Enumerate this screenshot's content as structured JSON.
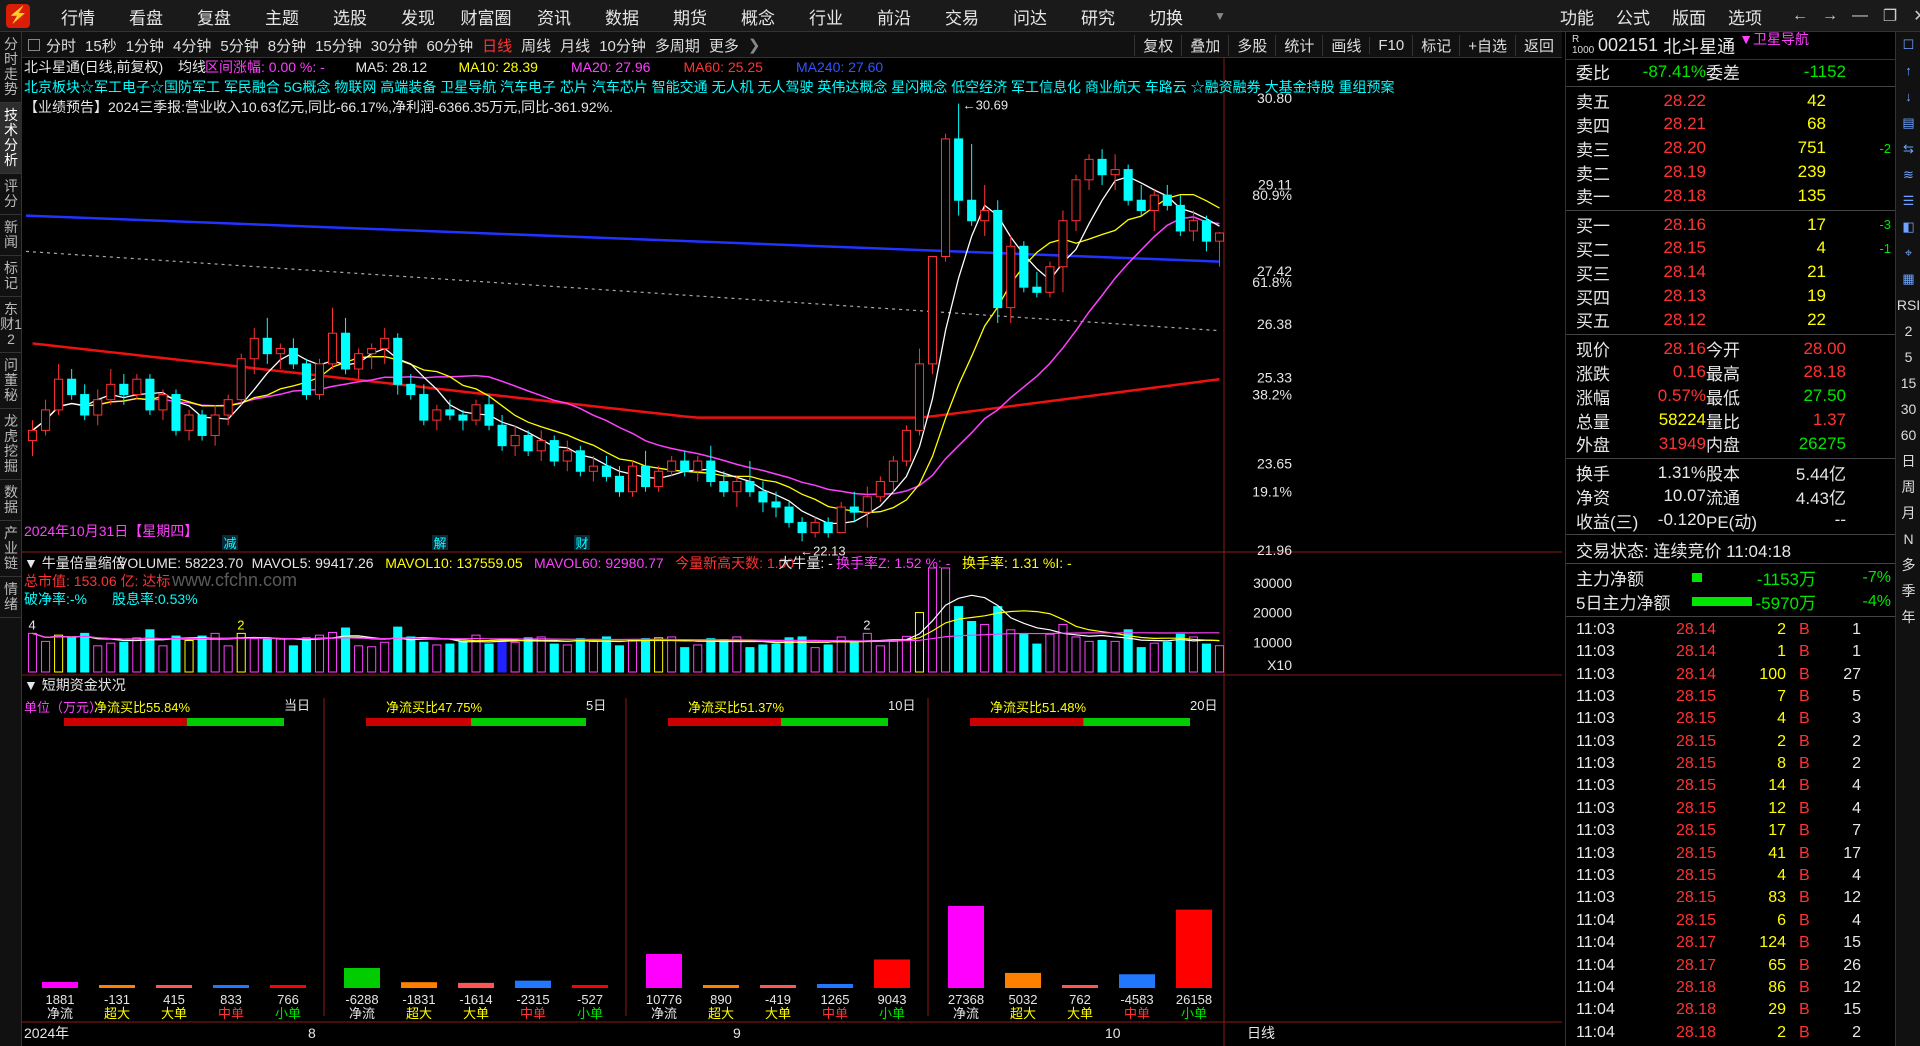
{
  "topbar": {
    "menu": [
      "行情",
      "看盘",
      "复盘",
      "主题",
      "选股",
      "发现",
      "财富圈",
      "资讯",
      "数据",
      "期货",
      "概念",
      "行业",
      "前沿",
      "交易",
      "问达",
      "研究",
      "切换"
    ],
    "right_menu": [
      "功能",
      "公式",
      "版面",
      "选项"
    ]
  },
  "left_tabs": [
    "分时走势",
    "技术分析",
    "评分",
    "新闻",
    "标记",
    "东财12",
    "问董秘",
    "龙虎挖掘",
    "数据",
    "产业链",
    "情绪"
  ],
  "periods": [
    "分时",
    "15秒",
    "1分钟",
    "4分钟",
    "5分钟",
    "8分钟",
    "15分钟",
    "30分钟",
    "60分钟",
    "日线",
    "周线",
    "月线",
    "10分钟",
    "多周期",
    "更多"
  ],
  "active_period": "日线",
  "period_tools": [
    "复权",
    "叠加",
    "多股",
    "统计",
    "画线",
    "F10",
    "标记",
    "+自选",
    "返回"
  ],
  "chart_header": {
    "title": "北斗星通(日线,前复权)",
    "ma_label": "均线",
    "range": "区间涨幅: 0.00 %: -",
    "ma5": "MA5: 28.12",
    "ma10": "MA10: 28.39",
    "ma20": "MA20: 27.96",
    "ma60": "MA60: 25.25",
    "ma240": "MA240: 27.60"
  },
  "concepts": "北京板块☆军工电子☆国防军工 军民融合 5G概念 物联网 高端装备 卫星导航 汽车电子 芯片 汽车芯片 智能交通 无人机 无人驾驶 英伟达概念 星闪概念 低空经济 军工信息化 商业航天 车路云 ☆融资融券 大基金持股 重组预案",
  "forecast": "【业绩预告】2024三季报:营业收入10.63亿元,同比-66.17%,净利润-6366.35万元,同比-361.92%.",
  "date_label": "2024年10月31日【星期四】",
  "high_label": "30.69",
  "low_label": "22.13",
  "event_marks": [
    "减",
    "解",
    "财"
  ],
  "price_axis": [
    "30.80",
    "29.11",
    "27.42",
    "26.38",
    "25.33",
    "23.65",
    "21.96"
  ],
  "pct_axis": [
    "80.9%",
    "61.8%",
    "38.2%",
    "19.1%"
  ],
  "volume_header": {
    "title": "牛量倍量缩倍",
    "volume": "VOLUME: 58223.70",
    "mavol5": "MAVOL5: 99417.26",
    "mavol10": "MAVOL10: 137559.05",
    "mavol60": "MAVOL60: 92980.77",
    "new_high": "今量新高天数: 1.00",
    "big": "大牛量: -",
    "turnz": "换手率Z: 1.52 %: -",
    "turn": "换手率: 1.31 %I: -",
    "watermark": "www.cfchn.com",
    "mcap": "总市值: 153.06 亿: 达标",
    "pb": "破净率:-%",
    "div": "股息率:0.53%"
  },
  "volume_axis": [
    "30000",
    "20000",
    "10000",
    "X10"
  ],
  "volume_marks": [
    "4",
    "2",
    "2"
  ],
  "fund_header": "短期资金状况",
  "fund_unit": "单位（万元）",
  "fund_panels": [
    {
      "period": "当日",
      "ratio": "净流买比55.84%",
      "values": [
        "1881",
        "-131",
        "415",
        "833",
        "766"
      ]
    },
    {
      "period": "5日",
      "ratio": "净流买比47.75%",
      "values": [
        "-6288",
        "-1831",
        "-1614",
        "-2315",
        "-527"
      ]
    },
    {
      "period": "10日",
      "ratio": "净流买比51.37%",
      "values": [
        "10776",
        "890",
        "-419",
        "1265",
        "9043"
      ]
    },
    {
      "period": "20日",
      "ratio": "净流买比51.48%",
      "values": [
        "27368",
        "5032",
        "762",
        "-4583",
        "26158"
      ]
    }
  ],
  "fund_labels": [
    "净流",
    "超大",
    "大单",
    "中单",
    "小单"
  ],
  "date_axis": [
    "2024年",
    "8",
    "9",
    "10"
  ],
  "bottom_period": "日线",
  "quote": {
    "code": "002151",
    "name": "北斗星通",
    "tag": "卫星导航",
    "wb_label": "委比",
    "wb": "-87.41%",
    "wc_label": "委差",
    "wc": "-1152",
    "asks": [
      {
        "l": "卖五",
        "p": "28.22",
        "v": "42",
        "c": ""
      },
      {
        "l": "卖四",
        "p": "28.21",
        "v": "68",
        "c": ""
      },
      {
        "l": "卖三",
        "p": "28.20",
        "v": "751",
        "c": "-2"
      },
      {
        "l": "卖二",
        "p": "28.19",
        "v": "239",
        "c": ""
      },
      {
        "l": "卖一",
        "p": "28.18",
        "v": "135",
        "c": ""
      }
    ],
    "bids": [
      {
        "l": "买一",
        "p": "28.16",
        "v": "17",
        "c": "-3"
      },
      {
        "l": "买二",
        "p": "28.15",
        "v": "4",
        "c": "-1"
      },
      {
        "l": "买三",
        "p": "28.14",
        "v": "21",
        "c": ""
      },
      {
        "l": "买四",
        "p": "28.13",
        "v": "19",
        "c": ""
      },
      {
        "l": "买五",
        "p": "28.12",
        "v": "22",
        "c": ""
      }
    ],
    "stats": [
      {
        "a": "现价",
        "b": "28.16",
        "c": "今开",
        "d": "28.00",
        "bc": "red",
        "dc": "red"
      },
      {
        "a": "涨跌",
        "b": "0.16",
        "c": "最高",
        "d": "28.18",
        "bc": "red",
        "dc": "red"
      },
      {
        "a": "涨幅",
        "b": "0.57%",
        "c": "最低",
        "d": "27.50",
        "bc": "red",
        "dc": "green"
      },
      {
        "a": "总量",
        "b": "58224",
        "c": "量比",
        "d": "1.37",
        "bc": "yellow",
        "dc": "red"
      },
      {
        "a": "外盘",
        "b": "31949",
        "c": "内盘",
        "d": "26275",
        "bc": "red",
        "dc": "green"
      }
    ],
    "stats2": [
      {
        "a": "换手",
        "b": "1.31%",
        "c": "股本",
        "d": "5.44亿"
      },
      {
        "a": "净资",
        "b": "10.07",
        "c": "流通",
        "d": "4.43亿"
      },
      {
        "a": "收益(三)",
        "b": "-0.120",
        "c": "PE(动)",
        "d": "--"
      }
    ],
    "trade_status": "交易状态: 连续竞价 11:04:18",
    "main_flow_label": "主力净额",
    "main_flow": "-1153万",
    "main_flow_pct": "-7%",
    "flow5_label": "5日主力净额",
    "flow5": "-5970万",
    "flow5_pct": "-4%",
    "ticks": [
      [
        "11:03",
        "28.14",
        "2",
        "B",
        "1"
      ],
      [
        "11:03",
        "28.14",
        "1",
        "B",
        "1"
      ],
      [
        "11:03",
        "28.14",
        "100",
        "B",
        "27"
      ],
      [
        "11:03",
        "28.15",
        "7",
        "B",
        "5"
      ],
      [
        "11:03",
        "28.15",
        "4",
        "B",
        "3"
      ],
      [
        "11:03",
        "28.15",
        "2",
        "B",
        "2"
      ],
      [
        "11:03",
        "28.15",
        "8",
        "B",
        "2"
      ],
      [
        "11:03",
        "28.15",
        "14",
        "B",
        "4"
      ],
      [
        "11:03",
        "28.15",
        "12",
        "B",
        "4"
      ],
      [
        "11:03",
        "28.15",
        "17",
        "B",
        "7"
      ],
      [
        "11:03",
        "28.15",
        "41",
        "B",
        "17"
      ],
      [
        "11:03",
        "28.15",
        "4",
        "B",
        "4"
      ],
      [
        "11:03",
        "28.15",
        "83",
        "B",
        "12"
      ],
      [
        "11:04",
        "28.15",
        "6",
        "B",
        "4"
      ],
      [
        "11:04",
        "28.17",
        "124",
        "B",
        "15"
      ],
      [
        "11:04",
        "28.17",
        "65",
        "B",
        "26"
      ],
      [
        "11:04",
        "28.18",
        "86",
        "B",
        "12"
      ],
      [
        "11:04",
        "28.18",
        "29",
        "B",
        "15"
      ],
      [
        "11:04",
        "28.18",
        "2",
        "B",
        "2"
      ]
    ]
  },
  "right_sidebar": [
    "RSI",
    "2",
    "5",
    "15",
    "30",
    "60",
    "日",
    "周",
    "月",
    "N",
    "多",
    "季",
    "年"
  ],
  "chart_data": {
    "type": "candlestick",
    "y_range": [
      21.96,
      30.8
    ],
    "candles": [
      [
        24.1,
        24.5,
        23.8,
        24.3
      ],
      [
        24.3,
        24.9,
        24.2,
        24.7
      ],
      [
        24.7,
        25.6,
        24.6,
        25.3
      ],
      [
        25.3,
        25.5,
        24.9,
        25.0
      ],
      [
        25.0,
        25.2,
        24.5,
        24.6
      ],
      [
        24.6,
        25.1,
        24.4,
        24.9
      ],
      [
        24.9,
        25.5,
        24.8,
        25.2
      ],
      [
        25.2,
        25.4,
        24.8,
        25.0
      ],
      [
        25.0,
        25.4,
        24.9,
        25.3
      ],
      [
        25.3,
        25.4,
        24.6,
        24.7
      ],
      [
        24.7,
        25.1,
        24.5,
        25.0
      ],
      [
        25.0,
        25.1,
        24.2,
        24.3
      ],
      [
        24.3,
        24.7,
        24.1,
        24.6
      ],
      [
        24.6,
        24.7,
        24.1,
        24.2
      ],
      [
        24.2,
        24.8,
        24.0,
        24.6
      ],
      [
        24.6,
        25.0,
        24.4,
        24.9
      ],
      [
        24.9,
        25.8,
        24.8,
        25.7
      ],
      [
        25.7,
        26.3,
        25.4,
        26.1
      ],
      [
        26.1,
        26.5,
        25.6,
        25.8
      ],
      [
        25.8,
        26.0,
        25.5,
        25.9
      ],
      [
        25.9,
        26.1,
        25.5,
        25.6
      ],
      [
        25.6,
        25.7,
        24.9,
        25.0
      ],
      [
        25.0,
        25.7,
        24.9,
        25.6
      ],
      [
        25.6,
        26.7,
        25.5,
        26.2
      ],
      [
        26.2,
        26.5,
        25.4,
        25.5
      ],
      [
        25.5,
        25.9,
        25.3,
        25.8
      ],
      [
        25.8,
        26.0,
        25.5,
        25.9
      ],
      [
        25.9,
        26.3,
        25.6,
        26.1
      ],
      [
        26.1,
        26.2,
        25.0,
        25.2
      ],
      [
        25.2,
        25.4,
        24.9,
        25.0
      ],
      [
        25.0,
        25.2,
        24.4,
        24.5
      ],
      [
        24.5,
        24.8,
        24.3,
        24.7
      ],
      [
        24.7,
        24.9,
        24.5,
        24.6
      ],
      [
        24.6,
        24.7,
        24.3,
        24.5
      ],
      [
        24.5,
        24.9,
        24.4,
        24.8
      ],
      [
        24.8,
        25.0,
        24.3,
        24.4
      ],
      [
        24.4,
        24.6,
        23.9,
        24.0
      ],
      [
        24.0,
        24.4,
        23.8,
        24.2
      ],
      [
        24.2,
        24.3,
        23.8,
        23.9
      ],
      [
        23.9,
        24.3,
        23.7,
        24.1
      ],
      [
        24.1,
        24.2,
        23.6,
        23.7
      ],
      [
        23.7,
        24.1,
        23.5,
        23.9
      ],
      [
        23.9,
        24.0,
        23.4,
        23.5
      ],
      [
        23.5,
        23.8,
        23.3,
        23.6
      ],
      [
        23.6,
        23.8,
        23.3,
        23.4
      ],
      [
        23.4,
        23.6,
        23.0,
        23.1
      ],
      [
        23.1,
        23.7,
        23.0,
        23.6
      ],
      [
        23.6,
        23.9,
        23.1,
        23.2
      ],
      [
        23.2,
        23.6,
        23.1,
        23.5
      ],
      [
        23.5,
        23.8,
        23.4,
        23.7
      ],
      [
        23.7,
        23.9,
        23.4,
        23.5
      ],
      [
        23.5,
        23.8,
        23.3,
        23.7
      ],
      [
        23.7,
        24.0,
        23.2,
        23.3
      ],
      [
        23.3,
        23.5,
        23.0,
        23.1
      ],
      [
        23.1,
        23.4,
        22.8,
        23.3
      ],
      [
        23.3,
        23.7,
        23.0,
        23.1
      ],
      [
        23.1,
        23.3,
        22.7,
        22.9
      ],
      [
        22.9,
        23.1,
        22.6,
        22.8
      ],
      [
        22.8,
        22.9,
        22.4,
        22.5
      ],
      [
        22.5,
        22.6,
        22.13,
        22.3
      ],
      [
        22.3,
        22.6,
        22.2,
        22.5
      ],
      [
        22.5,
        22.6,
        22.2,
        22.3
      ],
      [
        22.3,
        22.9,
        22.3,
        22.8
      ],
      [
        22.8,
        23.1,
        22.5,
        22.7
      ],
      [
        22.7,
        23.2,
        22.4,
        23.0
      ],
      [
        23.0,
        23.4,
        22.9,
        23.3
      ],
      [
        23.3,
        23.8,
        23.1,
        23.7
      ],
      [
        23.7,
        24.4,
        23.6,
        24.3
      ],
      [
        24.3,
        25.9,
        24.2,
        25.6
      ],
      [
        25.6,
        27.7,
        25.4,
        27.7
      ],
      [
        27.7,
        30.1,
        27.6,
        30.0
      ],
      [
        30.0,
        30.69,
        28.5,
        28.8
      ],
      [
        28.8,
        29.9,
        28.3,
        28.4
      ],
      [
        28.4,
        29.1,
        28.1,
        28.6
      ],
      [
        28.6,
        28.8,
        26.4,
        26.7
      ],
      [
        26.7,
        28.1,
        26.4,
        27.9
      ],
      [
        27.9,
        28.0,
        27.0,
        27.1
      ],
      [
        27.1,
        27.4,
        26.9,
        27.0
      ],
      [
        27.0,
        27.6,
        26.9,
        27.5
      ],
      [
        27.5,
        28.6,
        27.0,
        28.4
      ],
      [
        28.4,
        29.3,
        28.2,
        29.2
      ],
      [
        29.2,
        29.7,
        29.0,
        29.6
      ],
      [
        29.6,
        29.8,
        29.1,
        29.3
      ],
      [
        29.3,
        29.7,
        29.0,
        29.4
      ],
      [
        29.4,
        29.5,
        28.7,
        28.8
      ],
      [
        28.8,
        29.1,
        28.5,
        28.6
      ],
      [
        28.6,
        29.0,
        28.2,
        28.9
      ],
      [
        28.9,
        29.1,
        28.6,
        28.7
      ],
      [
        28.7,
        28.9,
        28.1,
        28.2
      ],
      [
        28.2,
        28.6,
        28.0,
        28.4
      ],
      [
        28.4,
        28.5,
        27.8,
        28.0
      ],
      [
        28.0,
        28.18,
        27.5,
        28.16
      ]
    ],
    "volume_range": [
      0,
      35000
    ]
  }
}
